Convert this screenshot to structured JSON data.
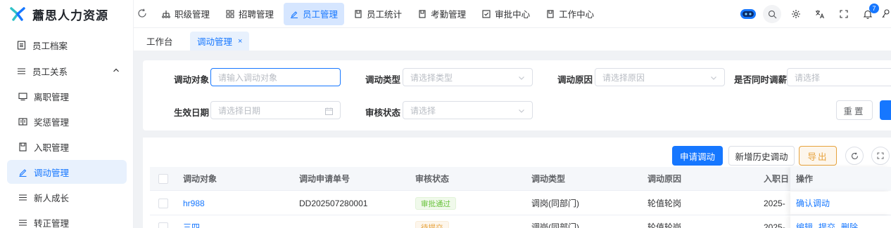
{
  "app": {
    "title": "蕭思人力资源"
  },
  "sidebar": {
    "items": [
      {
        "label": "员工档案",
        "icon": "document-list-icon"
      },
      {
        "label": "员工关系",
        "icon": "list-icon",
        "expanded": true
      },
      {
        "label": "离职管理",
        "icon": "monitor-icon"
      },
      {
        "label": "奖惩管理",
        "icon": "book-icon"
      },
      {
        "label": "入职管理",
        "icon": "file-icon"
      },
      {
        "label": "调动管理",
        "icon": "pen-icon",
        "active": true
      },
      {
        "label": "新人成长",
        "icon": "menu-icon"
      },
      {
        "label": "转正管理",
        "icon": "menu-icon"
      }
    ]
  },
  "topnav": {
    "items": [
      {
        "label": "职级管理",
        "icon": "org-icon"
      },
      {
        "label": "招聘管理",
        "icon": "grid-icon"
      },
      {
        "label": "员工管理",
        "icon": "pen-icon",
        "active": true
      },
      {
        "label": "员工统计",
        "icon": "file-icon"
      },
      {
        "label": "考勤管理",
        "icon": "file-icon"
      },
      {
        "label": "审批中心",
        "icon": "checkbox-icon"
      },
      {
        "label": "工作中心",
        "icon": "file-icon"
      }
    ],
    "notification_count": "7"
  },
  "tabs": [
    {
      "label": "工作台"
    },
    {
      "label": "调动管理",
      "active": true,
      "close": "×"
    }
  ],
  "filters": {
    "transfer_target": {
      "label": "调动对象",
      "placeholder": "请输入调动对象"
    },
    "transfer_type": {
      "label": "调动类型",
      "placeholder": "请选择类型"
    },
    "transfer_reason": {
      "label": "调动原因",
      "placeholder": "请选择原因"
    },
    "salary_adjust": {
      "label": "是否同时调薪",
      "placeholder": "请选择"
    },
    "effective_date": {
      "label": "生效日期",
      "placeholder": "请选择日期"
    },
    "review_status": {
      "label": "审核状态",
      "placeholder": "请选择"
    },
    "reset_label": "重置"
  },
  "toolbar": {
    "apply_label": "申请调动",
    "add_history_label": "新增历史调动",
    "export_label": "导出"
  },
  "table": {
    "columns": [
      "调动对象",
      "调动申请单号",
      "审核状态",
      "调动类型",
      "调动原因",
      "入职日",
      "操作"
    ],
    "rows": [
      {
        "target": "hr988",
        "order_no": "DD202507280001",
        "status": "审批通过",
        "type": "调岗(同部门)",
        "reason": "轮值轮岗",
        "hire_date": "2025-",
        "actions": [
          "确认调动"
        ]
      },
      {
        "target": "三四",
        "order_no": "",
        "status": "待提交",
        "type": "调岗(同部门)",
        "reason": "轮值轮岗",
        "hire_date": "2025-",
        "actions": [
          "编辑",
          "提交",
          "删除"
        ]
      }
    ]
  },
  "colors": {
    "primary": "#1677ff",
    "success": "#67c23a",
    "warning": "#e6a23c"
  }
}
